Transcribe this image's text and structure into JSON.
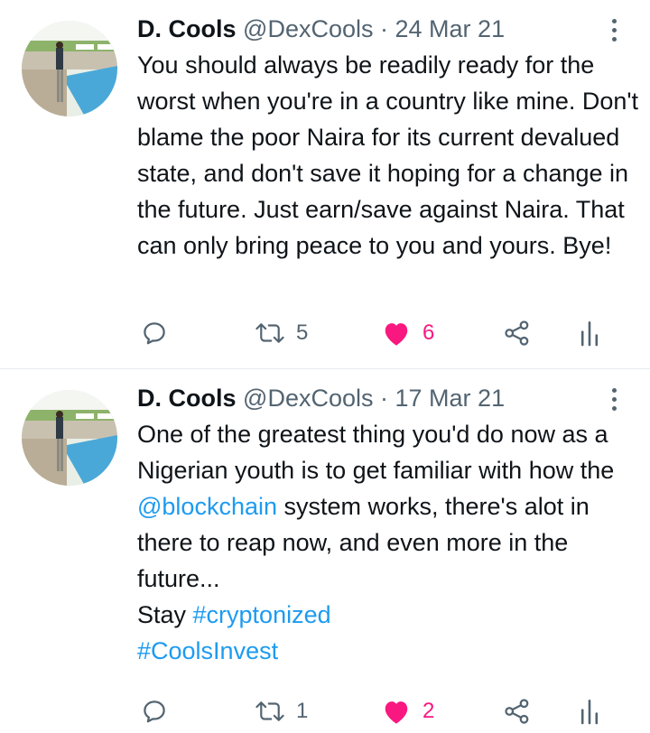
{
  "tweets": [
    {
      "name": "D. Cools",
      "handle": "@DexCools",
      "separator": "·",
      "date": "24 Mar 21",
      "text": "You should always be readily ready for the worst when you're in a country like mine. Don't blame the poor Naira for its current devalued state, and don't save it hoping for a change in the future. Just earn/save against Naira. That can only bring peace to you and yours. Bye!",
      "retweets": "5",
      "likes": "6",
      "liked": true
    },
    {
      "name": "D. Cools",
      "handle": "@DexCools",
      "separator": "·",
      "date": "17 Mar 21",
      "text_part1": "One of the greatest thing you'd do now as a Nigerian youth is to get familiar with how the ",
      "mention": "@blockchain",
      "text_part2": " system works, there's alot in there to reap now, and even more in the future...\nStay ",
      "hashtag1": "#cryptonized",
      "hashtag2": "#CoolsInvest",
      "retweets": "1",
      "likes": "2",
      "liked": true
    }
  ],
  "colors": {
    "text": "#0f1419",
    "secondary": "#536471",
    "link": "#1d9bf0",
    "like": "#f91880",
    "divider": "#e6ecf0"
  },
  "icons": [
    "reply-icon",
    "retweet-icon",
    "heart-icon",
    "share-icon",
    "analytics-icon",
    "more-icon"
  ]
}
